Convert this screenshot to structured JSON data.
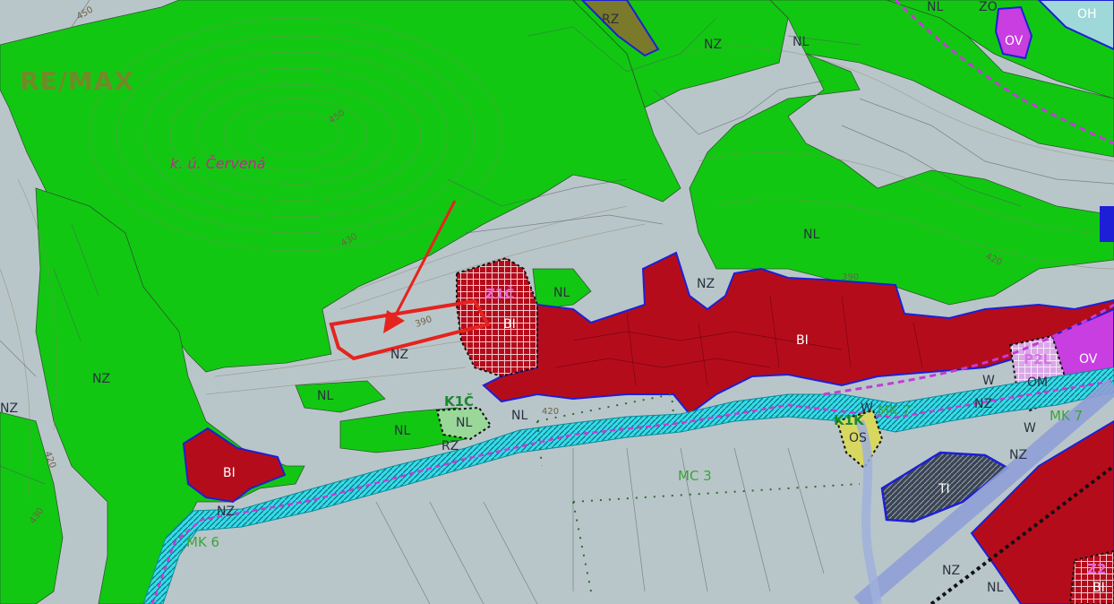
{
  "watermark": "RE/MAX",
  "place_label": "k. ú. Červená",
  "contour_labels": [
    "450",
    "430",
    "420",
    "420",
    "390",
    "390",
    "450",
    "420",
    "430"
  ],
  "zones": {
    "NL": "NL",
    "NZ": "NZ",
    "BI": "BI",
    "RZ": "RZ",
    "OV": "OV",
    "OH": "OH",
    "ZO": "ZO",
    "OM": "OM",
    "OS": "OS",
    "TI": "TI",
    "W": "W"
  },
  "codes": {
    "z1c": "Z1Č",
    "k1c": "K1Č",
    "k1k": "K1K",
    "p2l": "P2L",
    "z2": "Z2"
  },
  "roads": {
    "mk7a": "MK 7",
    "mk7b": "MK 7",
    "mc3": "MC 3",
    "mk6": "MK 6"
  },
  "colors": {
    "forest_nl": "#12c712",
    "agri_nz": "#b9c6c9",
    "housing_bi": "#b50c1c",
    "water_w": "#35dcea",
    "civic_ov": "#c83ee0",
    "highlight": "#e5231f",
    "boundary": "#1d1fd6"
  }
}
